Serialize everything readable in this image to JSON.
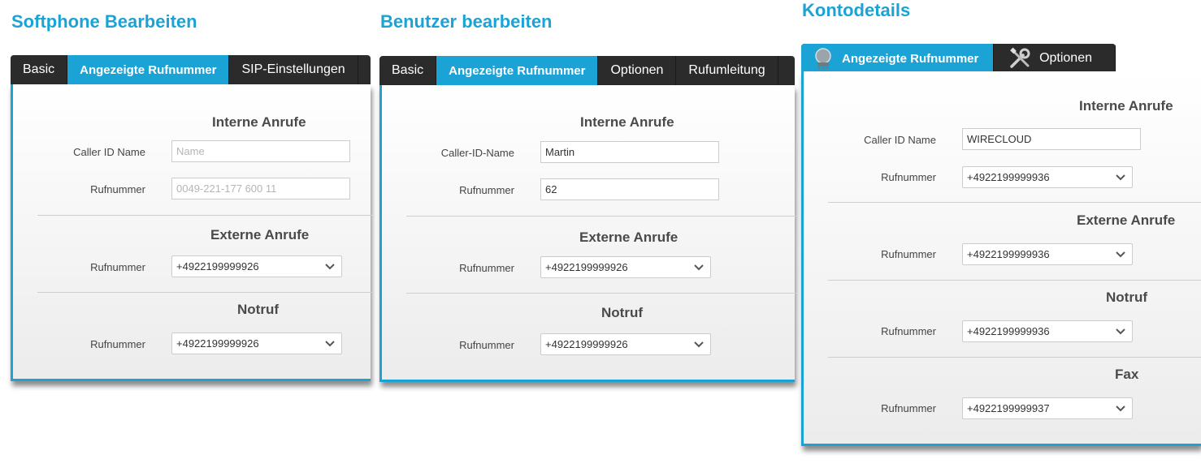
{
  "panels": [
    {
      "title": "Softphone Bearbeiten",
      "tabs": [
        "Basic",
        "Angezeigte Rufnummer",
        "SIP-Einstellungen"
      ],
      "sections": {
        "internal": {
          "title": "Interne Anrufe",
          "caller_id_label": "Caller ID Name",
          "caller_id_placeholder": "Name",
          "number_label": "Rufnummer",
          "number_placeholder": "0049-221-177 600 11"
        },
        "external": {
          "title": "Externe Anrufe",
          "number_label": "Rufnummer",
          "number_value": "+4922199999926"
        },
        "emergency": {
          "title": "Notruf",
          "number_label": "Rufnummer",
          "number_value": "+4922199999926"
        }
      }
    },
    {
      "title": "Benutzer bearbeiten",
      "tabs": [
        "Basic",
        "Angezeigte Rufnummer",
        "Optionen",
        "Rufumleitung"
      ],
      "sections": {
        "internal": {
          "title": "Interne Anrufe",
          "caller_id_label": "Caller-ID-Name",
          "caller_id_value": "Martin",
          "number_label": "Rufnummer",
          "number_value": "62"
        },
        "external": {
          "title": "Externe Anrufe",
          "number_label": "Rufnummer",
          "number_value": "+4922199999926"
        },
        "emergency": {
          "title": "Notruf",
          "number_label": "Rufnummer",
          "number_value": "+4922199999926"
        }
      }
    },
    {
      "title": "Kontodetails",
      "tabs": [
        {
          "label": "Angezeigte Rufnummer",
          "icon": "phone-icon"
        },
        {
          "label": "Optionen",
          "icon": "tools-icon"
        }
      ],
      "sections": {
        "internal": {
          "title": "Interne Anrufe",
          "caller_id_label": "Caller ID Name",
          "caller_id_value": "WIRECLOUD",
          "number_label": "Rufnummer",
          "number_value": "+4922199999936"
        },
        "external": {
          "title": "Externe Anrufe",
          "number_label": "Rufnummer",
          "number_value": "+4922199999936"
        },
        "emergency": {
          "title": "Notruf",
          "number_label": "Rufnummer",
          "number_value": "+4922199999936"
        },
        "fax": {
          "title": "Fax",
          "number_label": "Rufnummer",
          "number_value": "+4922199999937"
        }
      }
    }
  ],
  "colors": {
    "accent": "#1ba3d6",
    "tabbar": "#2b2b2b"
  }
}
